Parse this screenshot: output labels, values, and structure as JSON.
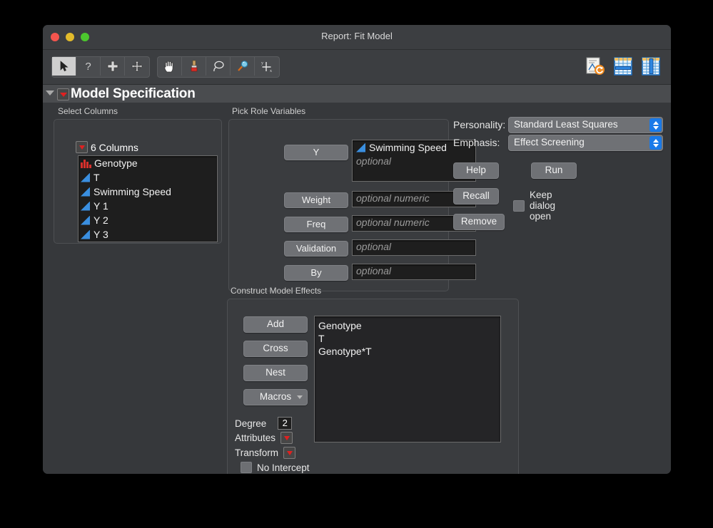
{
  "window": {
    "title": "Report: Fit Model",
    "traffic_lights": [
      "close",
      "minimize",
      "maximize"
    ]
  },
  "toolbar": {
    "group1": [
      {
        "name": "arrow-select-tool",
        "active": true
      },
      {
        "name": "question-help-tool",
        "active": false
      },
      {
        "name": "crosshair-plus-tool",
        "active": false
      },
      {
        "name": "move-arrows-tool",
        "active": false
      }
    ],
    "group2": [
      {
        "name": "hand-grabber-tool",
        "active": false
      },
      {
        "name": "brush-tool",
        "active": false
      },
      {
        "name": "lasso-tool",
        "active": false
      },
      {
        "name": "magnifier-tool",
        "active": false
      },
      {
        "name": "axis-crosshair-tool",
        "active": false
      }
    ],
    "right": [
      {
        "name": "journal-refresh-icon"
      },
      {
        "name": "table-row-select-icon"
      },
      {
        "name": "table-column-select-icon"
      }
    ]
  },
  "outline": {
    "title": "Model Specification",
    "disclosure": "expanded"
  },
  "select_columns": {
    "label": "Select Columns",
    "count_label": "6 Columns",
    "columns": [
      {
        "name": "Genotype",
        "type": "nominal"
      },
      {
        "name": "T",
        "type": "continuous"
      },
      {
        "name": "Swimming Speed",
        "type": "continuous"
      },
      {
        "name": "Y 1",
        "type": "continuous"
      },
      {
        "name": "Y 2",
        "type": "continuous"
      },
      {
        "name": "Y 3",
        "type": "continuous"
      }
    ]
  },
  "pick_role_variables": {
    "label": "Pick Role Variables",
    "roles": [
      {
        "button": "Y",
        "value": "Swimming Speed",
        "value_type": "continuous",
        "placeholder": "optional"
      },
      {
        "button": "Weight",
        "value": "",
        "placeholder": "optional numeric"
      },
      {
        "button": "Freq",
        "value": "",
        "placeholder": "optional numeric"
      },
      {
        "button": "Validation",
        "value": "",
        "placeholder": "optional"
      },
      {
        "button": "By",
        "value": "",
        "placeholder": "optional"
      }
    ]
  },
  "settings": {
    "personality_label": "Personality:",
    "personality_value": "Standard Least Squares",
    "emphasis_label": "Emphasis:",
    "emphasis_value": "Effect Screening",
    "help_label": "Help",
    "run_label": "Run",
    "recall_label": "Recall",
    "remove_label": "Remove",
    "keep_dialog_open_label": "Keep dialog open",
    "keep_dialog_open_checked": false
  },
  "construct_model_effects": {
    "label": "Construct Model Effects",
    "buttons": [
      "Add",
      "Cross",
      "Nest",
      "Macros"
    ],
    "effects": [
      "Genotype",
      "T",
      "Genotype*T"
    ],
    "degree_label": "Degree",
    "degree_value": "2",
    "attributes_label": "Attributes",
    "transform_label": "Transform",
    "no_intercept_label": "No Intercept",
    "no_intercept_checked": false
  },
  "colors": {
    "window_bg": "#36383b",
    "titlebar_bg": "#3c3e41",
    "list_bg": "#1e1e1e",
    "button_bg": "#6f7175",
    "accent_blue": "#1a7ae8",
    "nominal_red": "#d6302c",
    "continuous_blue": "#3a8fe0",
    "red_triangle": "#e02020"
  }
}
